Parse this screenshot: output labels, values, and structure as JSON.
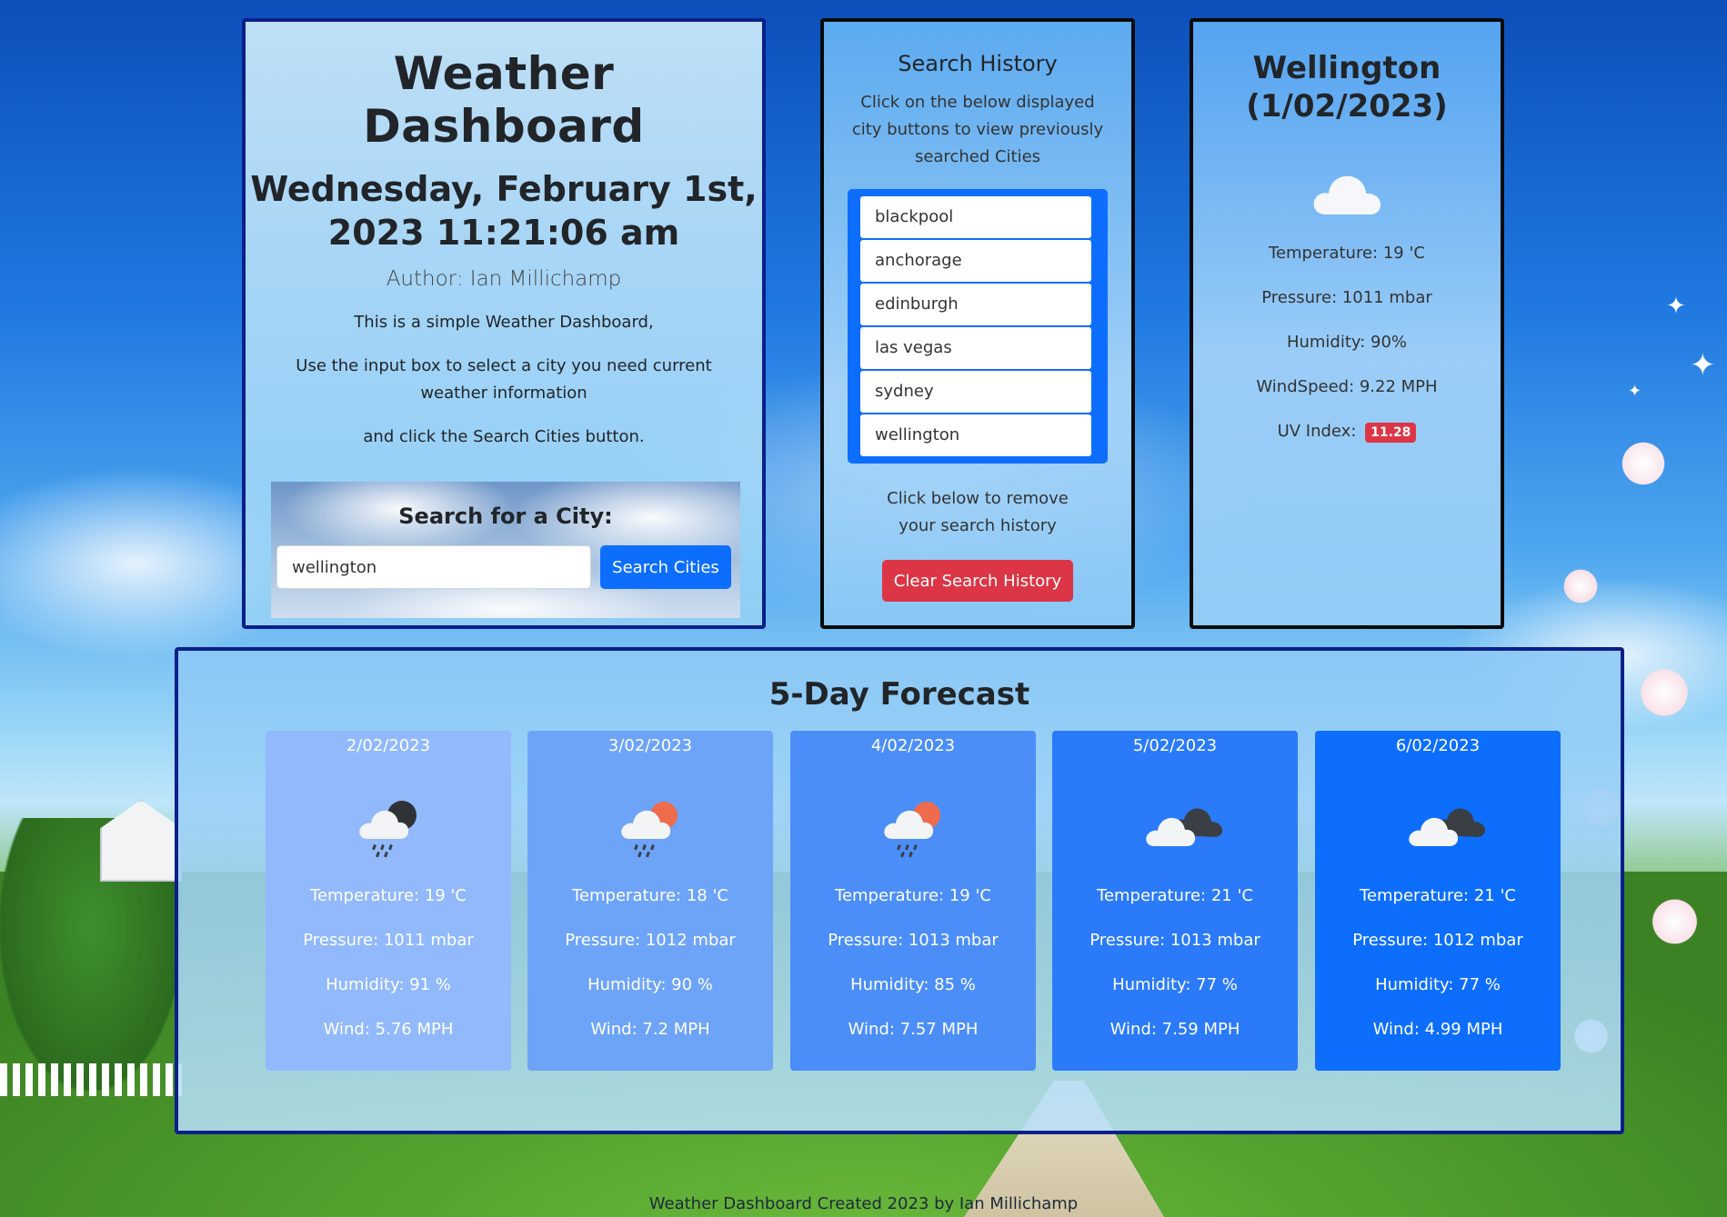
{
  "main": {
    "title": "Weather Dashboard",
    "datetime": "Wednesday, February 1st, 2023 11:21:06 am",
    "author": "Author: Ian Millichamp",
    "desc1": "This is a simple Weather Dashboard,",
    "desc2": "Use the input box to select a city you need current weather information",
    "desc3": "and click the Search Cities button.",
    "search": {
      "title": "Search for a City:",
      "value": "wellington",
      "button": "Search Cities"
    }
  },
  "history": {
    "title": "Search History",
    "desc": "Click on the below displayed city buttons to view previously searched Cities",
    "cities": [
      "blackpool",
      "anchorage",
      "edinburgh",
      "las vegas",
      "sydney",
      "wellington"
    ],
    "remove_text": "Click below to remove your search history",
    "clear_button": "Clear Search History"
  },
  "current": {
    "city": "Wellington",
    "date": "(1/02/2023)",
    "icon": "cloud-icon",
    "temperature": "Temperature: 19 'C",
    "pressure": "Pressure: 1011 mbar",
    "humidity": "Humidity: 90%",
    "windspeed": "WindSpeed: 9.22 MPH",
    "uv_label": "UV Index:",
    "uv_value": "11.28",
    "uv_color": "#dc3545"
  },
  "forecast": {
    "title": "5-Day Forecast",
    "days": [
      {
        "date": "2/02/2023",
        "icon": "rain-night-icon",
        "color": "#91b9fb",
        "temperature": "Temperature: 19 'C",
        "pressure": "Pressure: 1011 mbar",
        "humidity": "Humidity: 91 %",
        "wind": "Wind: 5.76 MPH"
      },
      {
        "date": "3/02/2023",
        "icon": "rain-sun-icon",
        "color": "#6ea4f8",
        "temperature": "Temperature: 18 'C",
        "pressure": "Pressure: 1012 mbar",
        "humidity": "Humidity: 90 %",
        "wind": "Wind: 7.2 MPH"
      },
      {
        "date": "4/02/2023",
        "icon": "rain-sun-icon",
        "color": "#4c8ef8",
        "temperature": "Temperature: 19 'C",
        "pressure": "Pressure: 1013 mbar",
        "humidity": "Humidity: 85 %",
        "wind": "Wind: 7.57 MPH"
      },
      {
        "date": "5/02/2023",
        "icon": "broken-clouds-icon",
        "color": "#2a7afa",
        "temperature": "Temperature: 21 'C",
        "pressure": "Pressure: 1013 mbar",
        "humidity": "Humidity: 77 %",
        "wind": "Wind: 7.59 MPH"
      },
      {
        "date": "6/02/2023",
        "icon": "broken-clouds-icon",
        "color": "#0d6efd",
        "temperature": "Temperature: 21 'C",
        "pressure": "Pressure: 1012 mbar",
        "humidity": "Humidity: 77 %",
        "wind": "Wind: 4.99 MPH"
      }
    ]
  },
  "footer": "Weather Dashboard Created 2023 by Ian Millichamp"
}
